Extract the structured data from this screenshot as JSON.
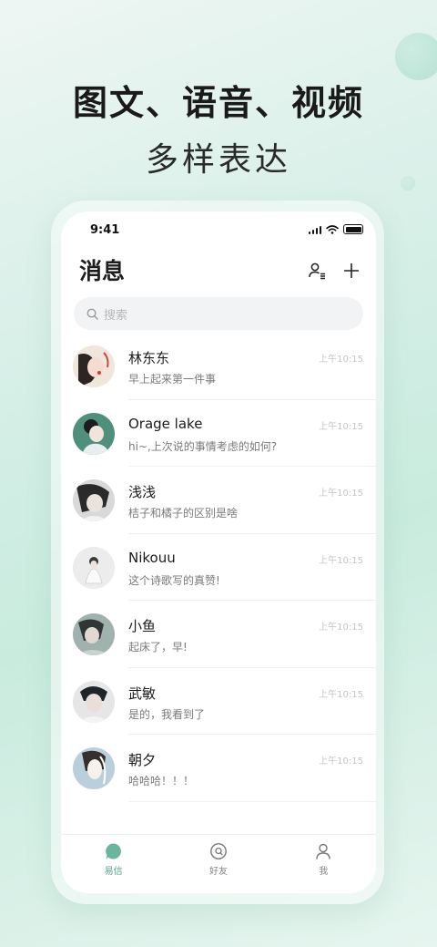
{
  "promo": {
    "headline": "图文、语音、视频",
    "subline": "多样表达"
  },
  "status_bar": {
    "time": "9:41"
  },
  "header": {
    "title": "消息"
  },
  "search": {
    "placeholder": "搜索"
  },
  "chats": [
    {
      "name": "林东东",
      "message": "早上起来第一件事",
      "time": "上午10:15"
    },
    {
      "name": "Orage lake",
      "message": "hi~,上次说的事情考虑的如何?",
      "time": "上午10:15"
    },
    {
      "name": "浅浅",
      "message": "桔子和橘子的区别是啥",
      "time": "上午10:15"
    },
    {
      "name": "Nikouu",
      "message": "这个诗歌写的真赞!",
      "time": "上午10:15"
    },
    {
      "name": "小鱼",
      "message": "起床了，早!",
      "time": "上午10:15"
    },
    {
      "name": "武敏",
      "message": "是的，我看到了",
      "time": "上午10:15"
    },
    {
      "name": "朝夕",
      "message": "哈哈哈！！！",
      "time": "上午10:15"
    }
  ],
  "tabbar": {
    "tabs": [
      {
        "label": "易信",
        "icon": "chat-bubble-icon",
        "active": true
      },
      {
        "label": "好友",
        "icon": "friends-icon",
        "active": false
      },
      {
        "label": "我",
        "icon": "profile-icon",
        "active": false
      }
    ]
  },
  "colors": {
    "accent": "#5aa48f",
    "background": "#d6efe7"
  }
}
